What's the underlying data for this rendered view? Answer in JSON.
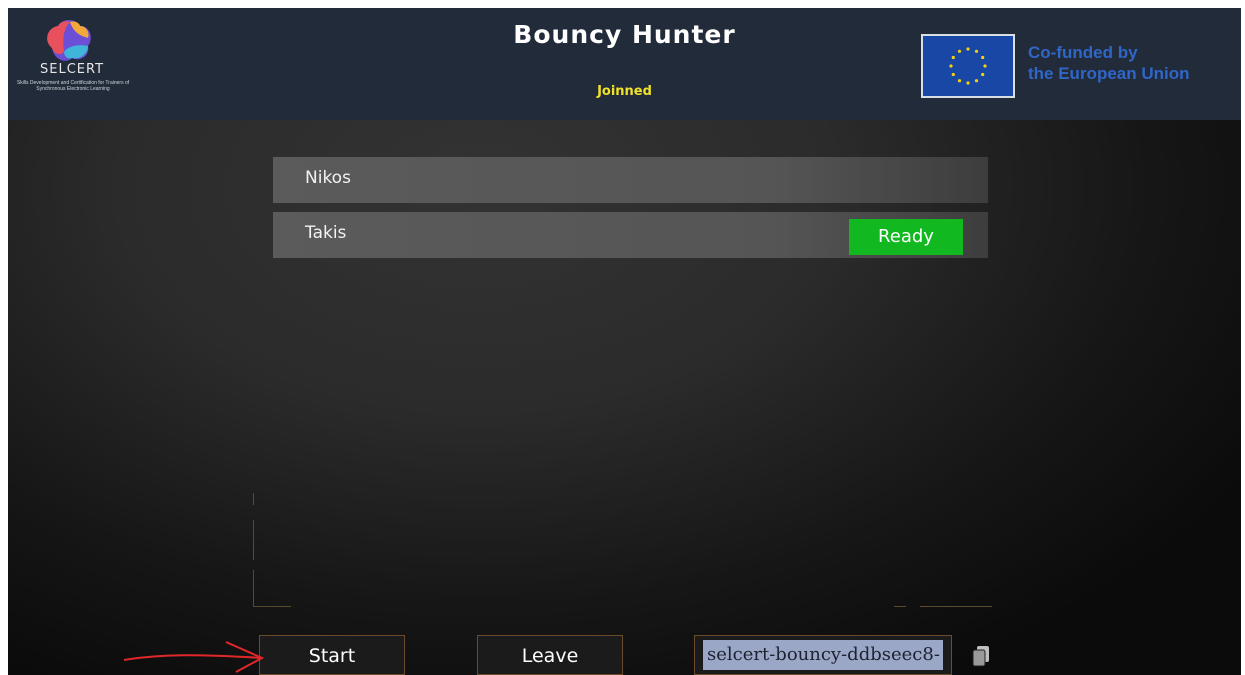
{
  "header": {
    "logo": {
      "name": "SELCERT",
      "tagline": "Skills Development and Certification for Trainers of Synchronous Electronic Learning"
    },
    "title": "Bouncy Hunter",
    "status": "Joinned",
    "eu_emblem": {
      "text_line1": "Co-funded by",
      "text_line2": "the European Union"
    }
  },
  "players": [
    {
      "name": "Nikos",
      "ready": false,
      "ready_label": ""
    },
    {
      "name": "Takis",
      "ready": true,
      "ready_label": "Ready"
    }
  ],
  "controls": {
    "start_label": "Start",
    "leave_label": "Leave",
    "room_code": "selcert-bouncy-ddbseec8-",
    "copy_icon": "copy-icon"
  },
  "colors": {
    "header_bg": "#222b3a",
    "title": "#ffffff",
    "status": "#f0e22a",
    "ready_badge": "#12b81f",
    "eu_text": "#2f66c8",
    "annotation": "#e0282a"
  }
}
